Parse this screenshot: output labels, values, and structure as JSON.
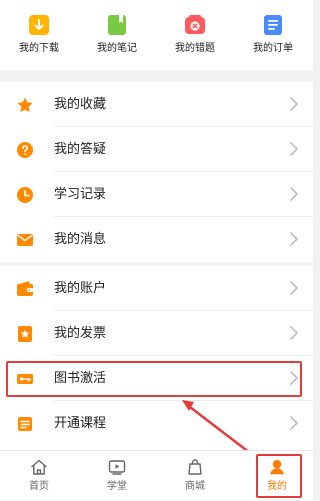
{
  "quick_actions": [
    {
      "label": "我的下载",
      "icon": "download-icon",
      "color": "#ffb400"
    },
    {
      "label": "我的笔记",
      "icon": "notes-icon",
      "color": "#7ac943"
    },
    {
      "label": "我的错题",
      "icon": "wrong-questions-icon",
      "color": "#ff5a5f"
    },
    {
      "label": "我的订单",
      "icon": "orders-icon",
      "color": "#4a8cff"
    }
  ],
  "sections": [
    {
      "items": [
        {
          "label": "我的收藏",
          "icon": "star-icon",
          "color": "#ff8a00"
        },
        {
          "label": "我的答疑",
          "icon": "question-icon",
          "color": "#ff8a00"
        },
        {
          "label": "学习记录",
          "icon": "clock-icon",
          "color": "#ff8a00"
        },
        {
          "label": "我的消息",
          "icon": "envelope-icon",
          "color": "#ff8a00"
        }
      ]
    },
    {
      "items": [
        {
          "label": "我的账户",
          "icon": "wallet-icon",
          "color": "#ff8a00"
        },
        {
          "label": "我的发票",
          "icon": "invoice-icon",
          "color": "#ff8a00"
        },
        {
          "label": "图书激活",
          "icon": "key-icon",
          "color": "#ff8a00"
        },
        {
          "label": "开通课程",
          "icon": "course-icon",
          "color": "#ff8a00"
        }
      ]
    }
  ],
  "bottom_nav": {
    "tabs": [
      {
        "label": "首页",
        "icon": "home-icon",
        "active": false
      },
      {
        "label": "学堂",
        "icon": "video-icon",
        "active": false
      },
      {
        "label": "商城",
        "icon": "shop-icon",
        "active": false
      },
      {
        "label": "我的",
        "icon": "profile-icon",
        "active": true
      }
    ]
  },
  "colors": {
    "accent": "#ff8a00",
    "annotation_red": "#e53b3b"
  }
}
